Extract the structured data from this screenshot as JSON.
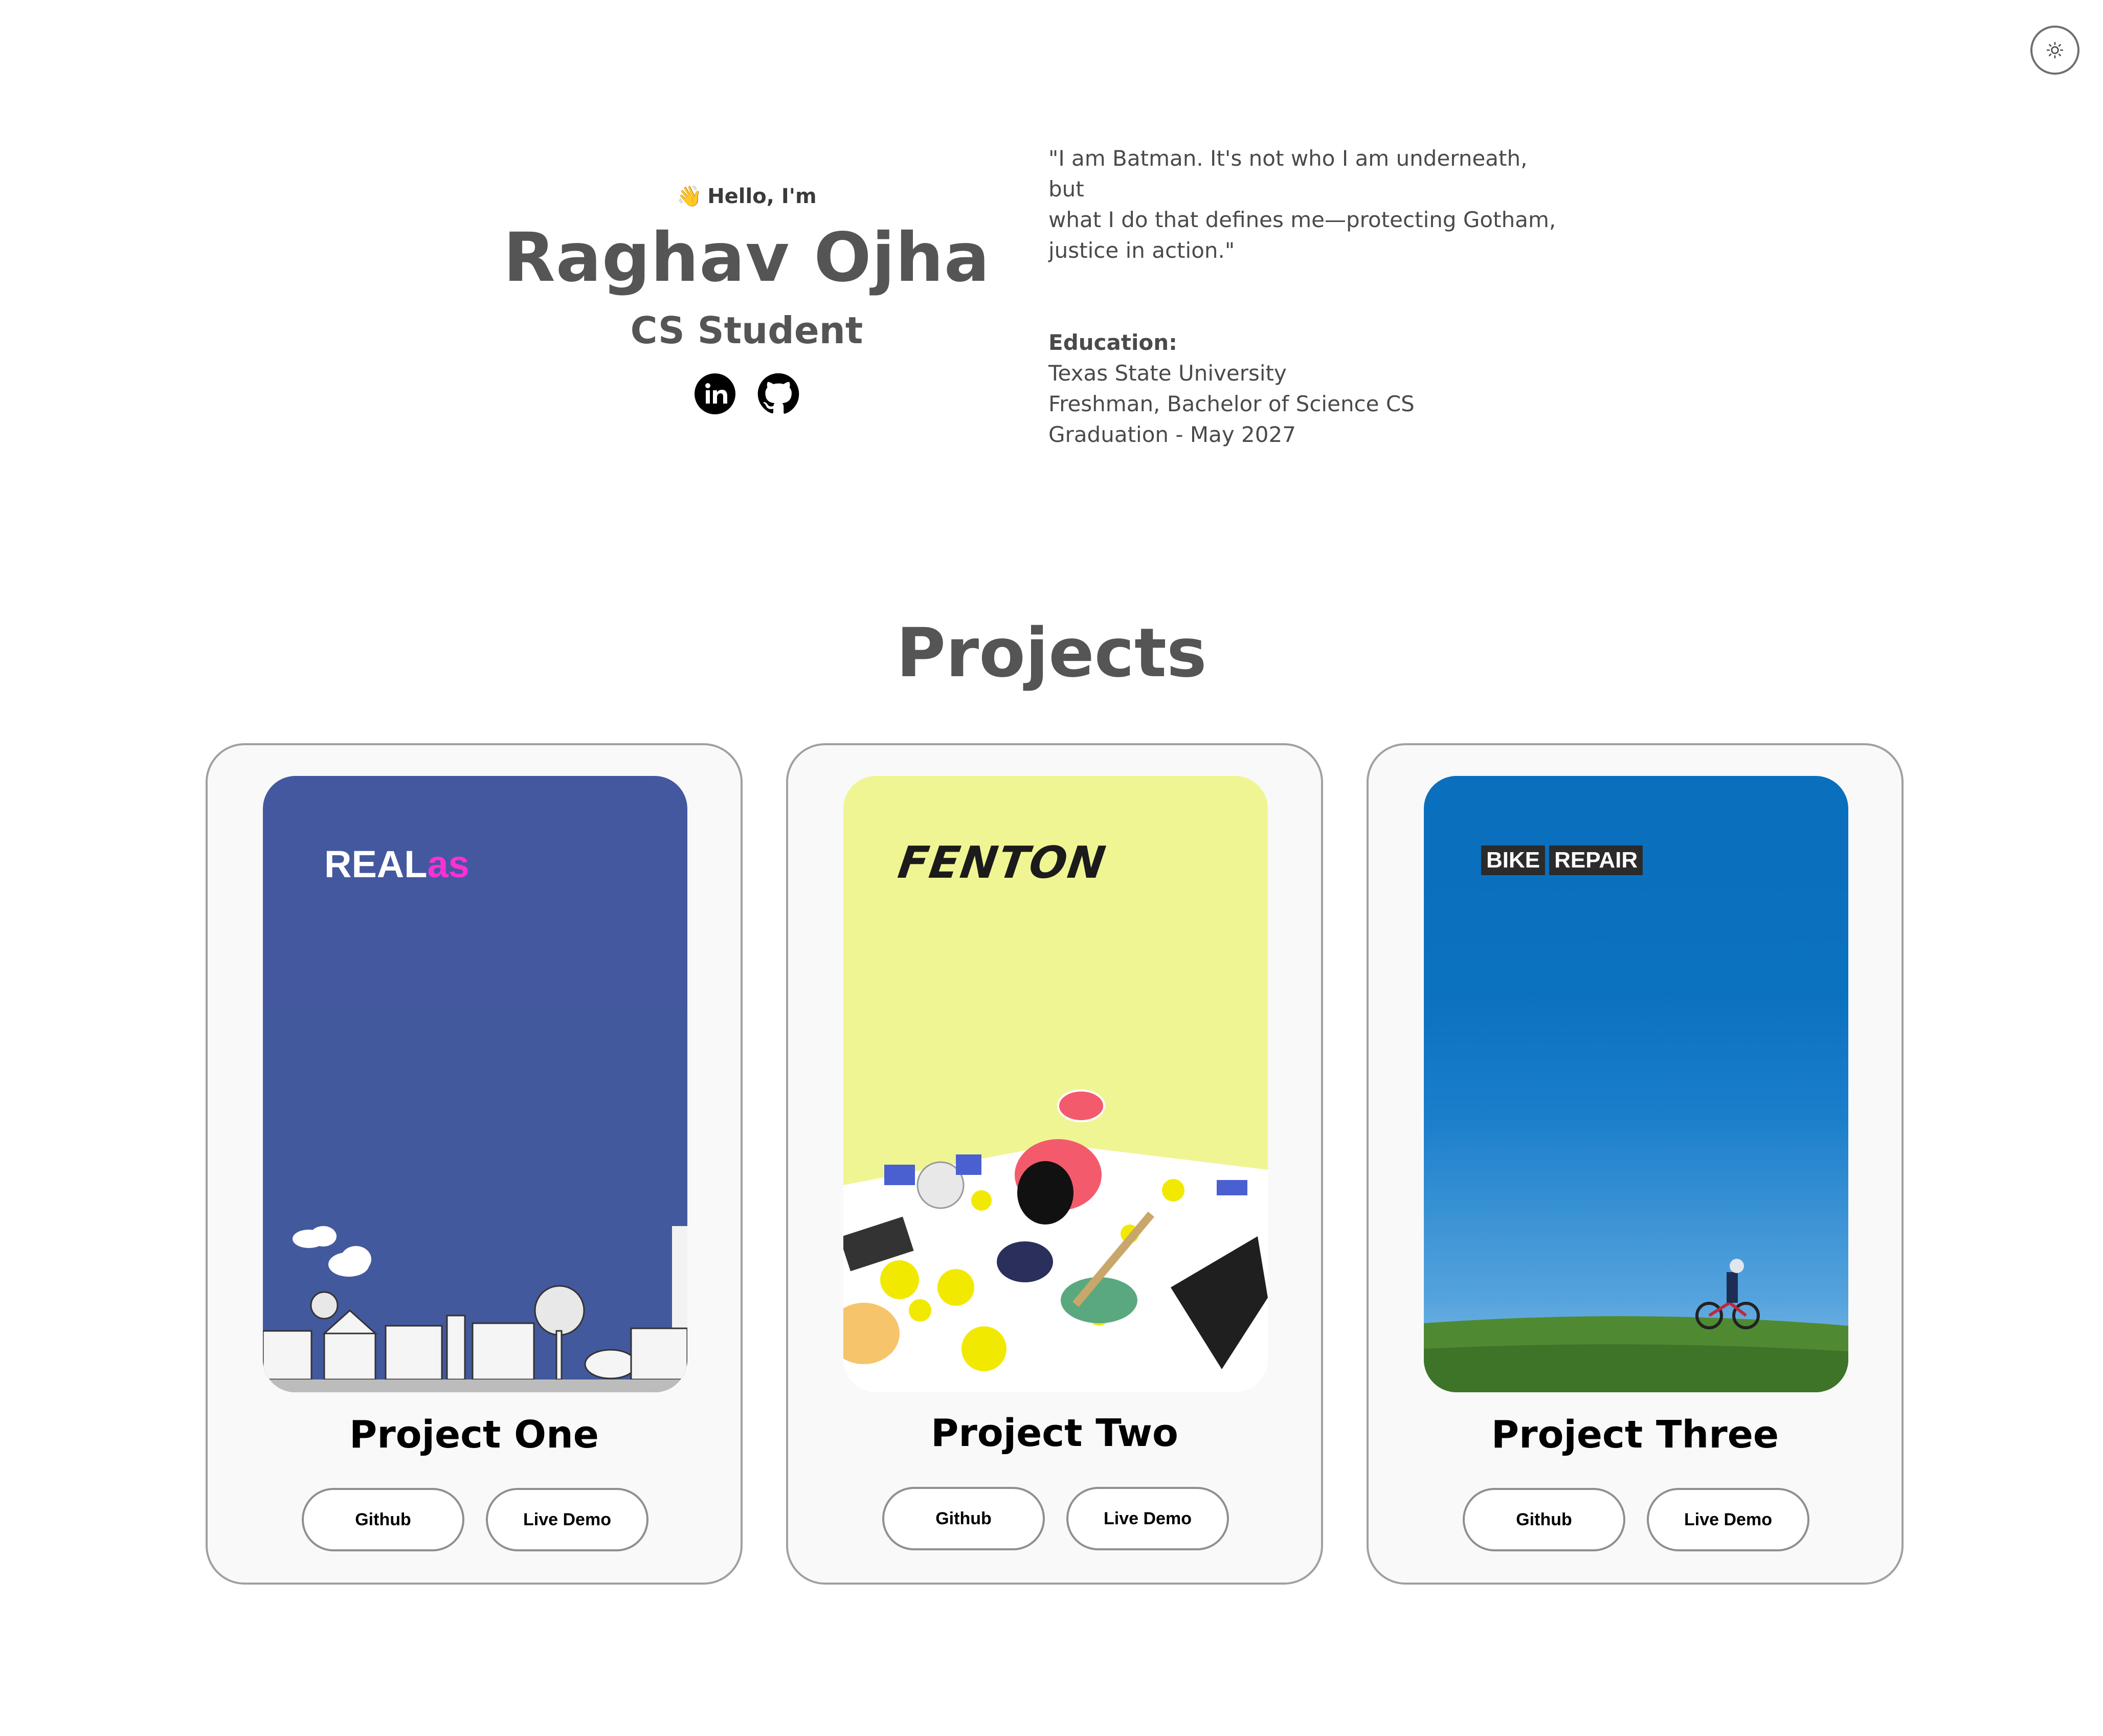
{
  "theme_toggle": {
    "icon": "sun-icon"
  },
  "hero": {
    "greeting_icon": "waving-hand-icon",
    "greeting_emoji": "👋",
    "greeting": "Hello, I'm",
    "name": "Raghav Ojha",
    "role": "CS Student",
    "socials": [
      {
        "name": "LinkedIn",
        "icon": "linkedin-icon"
      },
      {
        "name": "GitHub",
        "icon": "github-icon"
      }
    ]
  },
  "about": {
    "quote": "\"I am Batman. It's not who I am underneath, but\nwhat I do that defines me—protecting Gotham,\njustice in action.\"",
    "education_label": "Education:",
    "education_lines": [
      "Texas State University",
      "Freshman, Bachelor of Science CS",
      "Graduation - May 2027"
    ]
  },
  "projects": {
    "title": "Projects",
    "items": [
      {
        "title": "Project One",
        "logo_main": "REAL",
        "logo_accent": "as",
        "github_label": "Github",
        "demo_label": "Live Demo",
        "bg": "#44589f"
      },
      {
        "title": "Project Two",
        "logo": "FENTON",
        "github_label": "Github",
        "demo_label": "Live Demo",
        "bg": "#f0f593"
      },
      {
        "title": "Project Three",
        "logo_words": [
          "BIKE",
          "REPAIR"
        ],
        "github_label": "Github",
        "demo_label": "Live Demo",
        "bg": "#0a6fbd"
      }
    ]
  },
  "colors": {
    "text": "#555555",
    "card_border": "#a0a0a0",
    "card_bg": "#f9f9f9",
    "accent_pink": "#ff2fd6"
  }
}
